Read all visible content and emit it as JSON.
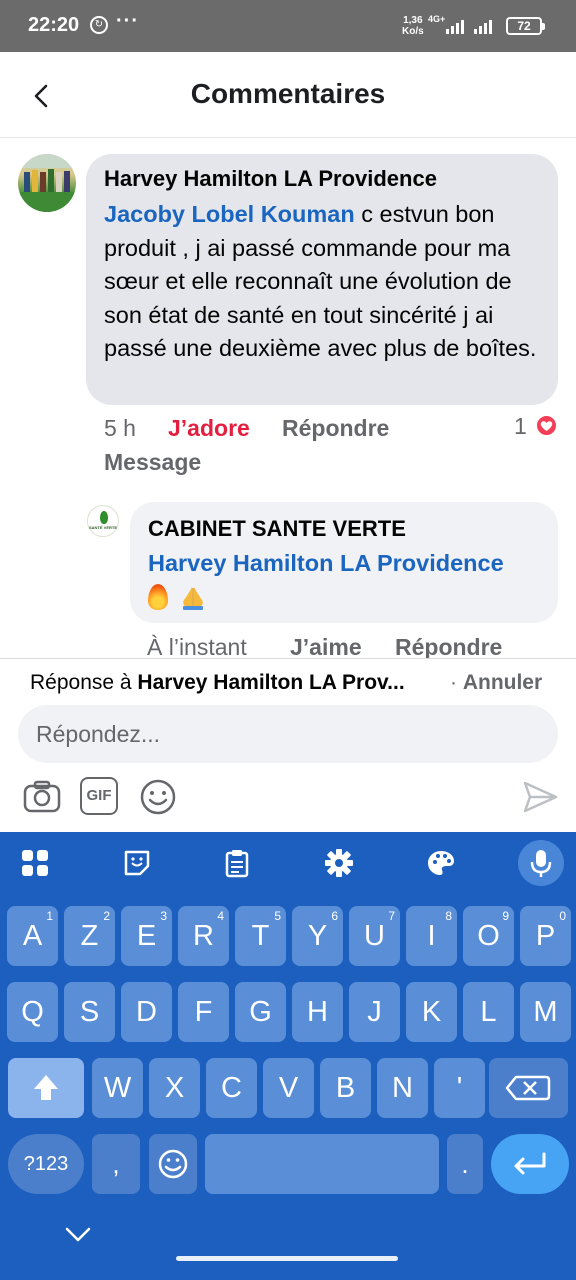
{
  "status_bar": {
    "time": "22:20",
    "dots": "···",
    "speed_top": "1,36",
    "speed_unit": "Ko/s",
    "network": "4G+",
    "battery": "72"
  },
  "header": {
    "title": "Commentaires"
  },
  "comment": {
    "author": "Harvey Hamilton LA Providence",
    "mention": "Jacoby Lobel Kouman",
    "text": " c estvun bon produit , j ai passé commande pour ma sœur et elle reconnaît une évolution de son état de santé en tout sincérité j ai passé une deuxième avec plus de boîtes.",
    "time": "5 h",
    "reaction_label": "J’adore",
    "reply_label": "Répondre",
    "message_label": "Message",
    "reaction_count": "1",
    "reaction_color": "#f33e58",
    "reaction_label_color": "#e41e3f"
  },
  "reply_comment": {
    "avatar_text": "SANTÉ VERTE",
    "author": "CABINET SANTE VERTE",
    "mention": "Harvey Hamilton LA Providence",
    "time": "À l’instant",
    "like_label": "J’aime",
    "reply_label": "Répondre"
  },
  "composer": {
    "reply_prefix": "Réponse à ",
    "reply_target": "Harvey Hamilton LA Prov...",
    "cancel_sep": "· ",
    "cancel_label": "Annuler",
    "placeholder": "Répondez...",
    "gif_label": "GIF"
  },
  "keyboard": {
    "row1": [
      {
        "key": "A",
        "num": "1"
      },
      {
        "key": "Z",
        "num": "2"
      },
      {
        "key": "E",
        "num": "3"
      },
      {
        "key": "R",
        "num": "4"
      },
      {
        "key": "T",
        "num": "5"
      },
      {
        "key": "Y",
        "num": "6"
      },
      {
        "key": "U",
        "num": "7"
      },
      {
        "key": "I",
        "num": "8"
      },
      {
        "key": "O",
        "num": "9"
      },
      {
        "key": "P",
        "num": "0"
      }
    ],
    "row2": [
      "Q",
      "S",
      "D",
      "F",
      "G",
      "H",
      "J",
      "K",
      "L",
      "M"
    ],
    "row3": [
      "W",
      "X",
      "C",
      "V",
      "B",
      "N",
      "'"
    ],
    "symbols_label": "?123",
    "comma": ",",
    "period": ".",
    "accent": "#1c5fbe"
  }
}
